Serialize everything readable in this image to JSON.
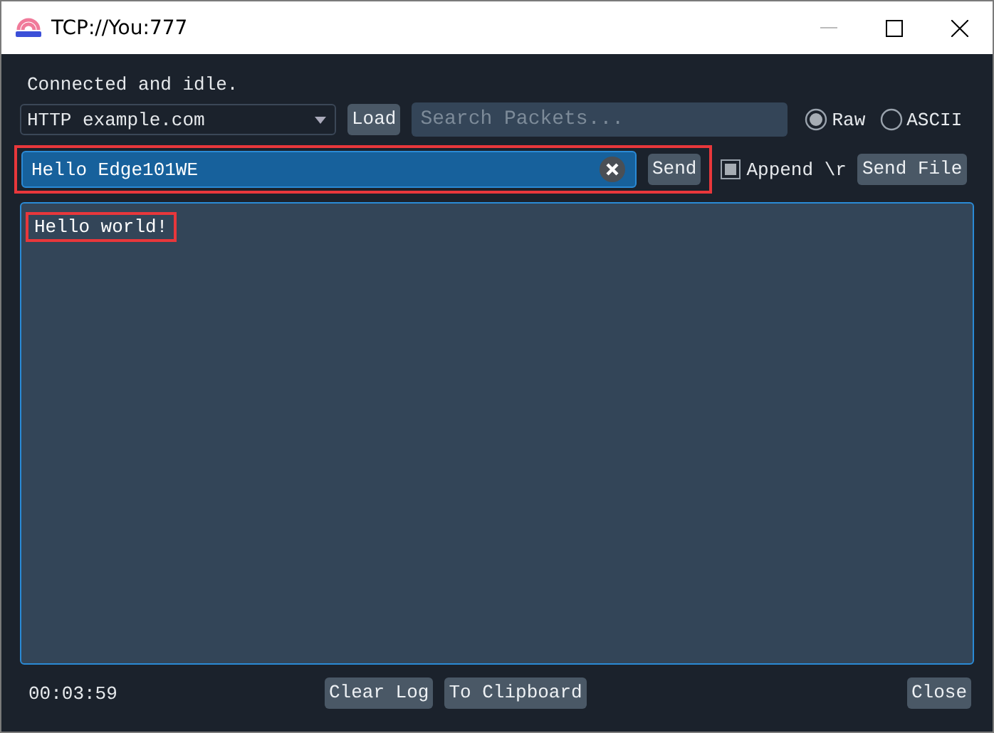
{
  "window": {
    "title": "TCP://You:777"
  },
  "status": "Connected and idle.",
  "preset": {
    "value": "HTTP example.com"
  },
  "load_button": "Load",
  "search": {
    "placeholder": "Search Packets..."
  },
  "modes": [
    {
      "label": "Raw",
      "selected": true
    },
    {
      "label": "ASCII",
      "selected": false
    }
  ],
  "message": {
    "value": "Hello Edge101WE",
    "highlighted": true
  },
  "send_button": "Send",
  "append": {
    "label": "Append \\r",
    "checked": true
  },
  "send_file_button": "Send File",
  "log": [
    {
      "text": "Hello world!",
      "highlighted": true
    }
  ],
  "elapsed": "00:03:59",
  "footer_buttons": [
    {
      "label": "Clear Log",
      "kind": "left"
    },
    {
      "label": "To Clipboard",
      "kind": "left"
    },
    {
      "label": "Close",
      "kind": "right"
    }
  ]
}
